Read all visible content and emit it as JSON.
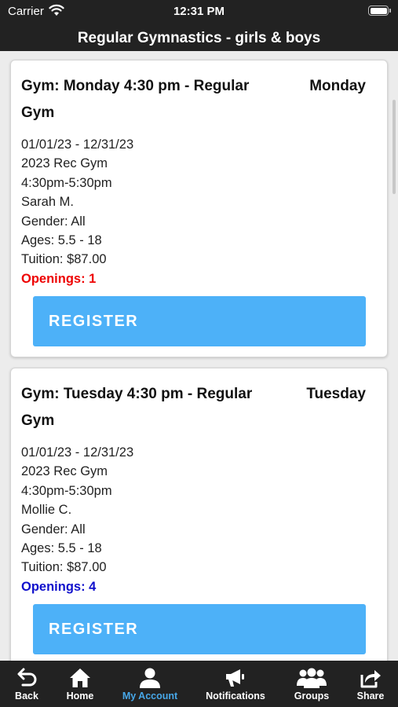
{
  "status_bar": {
    "carrier": "Carrier",
    "time": "12:31 PM"
  },
  "header": {
    "title": "Regular Gymnastics - girls & boys"
  },
  "classes": [
    {
      "title": "Gym: Monday 4:30 pm - Regular Gym",
      "day": "Monday",
      "dates": "01/01/23 - 12/31/23",
      "program": "2023 Rec Gym",
      "time": "4:30pm-5:30pm",
      "instructor": "Sarah M.",
      "gender": "Gender: All",
      "ages": "Ages: 5.5 - 18",
      "tuition": "Tuition: $87.00",
      "openings": "Openings: 1",
      "openings_color": "#ee0000",
      "register_label": "REGISTER"
    },
    {
      "title": "Gym: Tuesday 4:30 pm - Regular Gym",
      "day": "Tuesday",
      "dates": "01/01/23 - 12/31/23",
      "program": "2023 Rec Gym",
      "time": "4:30pm-5:30pm",
      "instructor": "Mollie C.",
      "gender": "Gender: All",
      "ages": "Ages: 5.5 - 18",
      "tuition": "Tuition: $87.00",
      "openings": "Openings: 4",
      "openings_color": "#1010cc",
      "register_label": "REGISTER"
    }
  ],
  "tab_bar": {
    "active_color": "#47a7e8",
    "tabs": [
      {
        "label": "Back",
        "icon": "back-arrow-icon"
      },
      {
        "label": "Home",
        "icon": "home-icon"
      },
      {
        "label": "My Account",
        "icon": "person-icon",
        "active": true
      },
      {
        "label": "Notifications",
        "icon": "megaphone-icon"
      },
      {
        "label": "Groups",
        "icon": "group-icon"
      },
      {
        "label": "Share",
        "icon": "share-icon"
      }
    ]
  }
}
